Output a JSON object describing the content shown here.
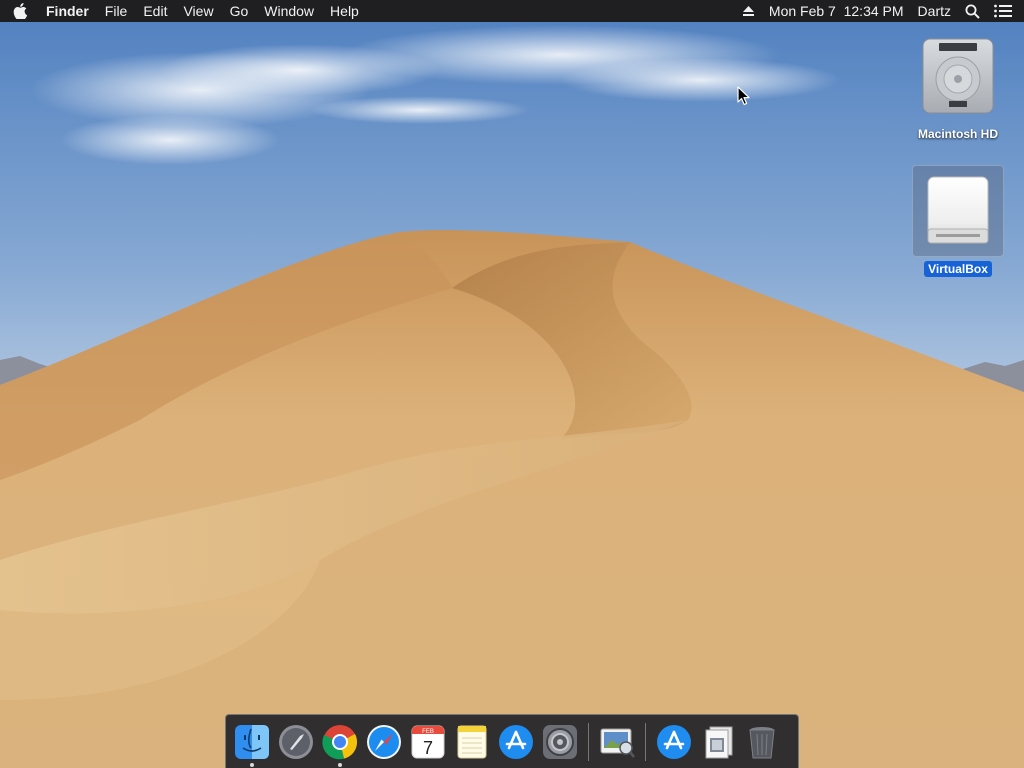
{
  "menubar": {
    "apple_icon": "apple-logo-icon",
    "app_name": "Finder",
    "menus": [
      "File",
      "Edit",
      "View",
      "Go",
      "Window",
      "Help"
    ],
    "status": {
      "eject_icon": "eject-icon",
      "clock": "Mon Feb 7  12:34 PM",
      "user": "Dartz",
      "search_icon": "spotlight-search-icon",
      "notification_icon": "notification-center-icon"
    }
  },
  "desktop": {
    "icons": [
      {
        "label": "Macintosh HD",
        "icon": "hard-drive-icon",
        "selected": false
      },
      {
        "label": "VirtualBox",
        "icon": "external-disk-icon",
        "selected": true
      }
    ]
  },
  "dock": {
    "items": [
      {
        "name": "Finder",
        "icon": "finder-icon",
        "running": true
      },
      {
        "name": "Launchpad",
        "icon": "launchpad-icon",
        "running": false
      },
      {
        "name": "Google Chrome",
        "icon": "chrome-icon",
        "running": true
      },
      {
        "name": "Safari",
        "icon": "safari-icon",
        "running": false
      },
      {
        "name": "Calendar",
        "icon": "calendar-icon",
        "running": false,
        "month": "FEB",
        "day": "7"
      },
      {
        "name": "Notes",
        "icon": "notes-icon",
        "running": false
      },
      {
        "name": "App Store",
        "icon": "app-store-icon",
        "running": false
      },
      {
        "name": "System Preferences",
        "icon": "system-preferences-icon",
        "running": false
      },
      {
        "name": "Preview",
        "icon": "preview-icon",
        "running": false
      },
      {
        "name": "Applications",
        "icon": "applications-folder-icon",
        "running": false
      },
      {
        "name": "Documents",
        "icon": "documents-stack-icon",
        "running": false
      },
      {
        "name": "Trash",
        "icon": "trash-icon",
        "running": false
      }
    ]
  },
  "colors": {
    "menubar_bg": "#1f1f22",
    "selection": "#1763d6",
    "sky": "#7aa2d2",
    "sand": "#d7ad72"
  }
}
